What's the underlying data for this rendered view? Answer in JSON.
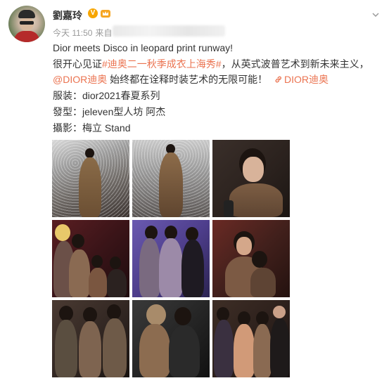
{
  "post": {
    "username": "劉嘉玲",
    "verified_badge": "V",
    "time": "今天 11:50",
    "source_prefix": "来自",
    "line1": "Dior meets Disco in leopard print runway!",
    "line2_prefix": "很开心见证",
    "line2_hashtag": "#迪奥二一秋季成衣上海秀#",
    "line2_suffix": "，从英式波普艺术到新未来主义，",
    "line3_mention": "@DIOR迪奥",
    "line3_text": " 始终都在诠释时装艺术的无限可能！",
    "line3_link_icon": "link-icon",
    "line3_link": "DIOR迪奥",
    "line4": "服装：dior2021春夏系列",
    "line5": "發型：jeleven型人坊 阿杰",
    "line6": "攝影：梅立 Stand"
  },
  "photos": [
    {
      "id": "photo-1",
      "desc": "runway-sequin-backdrop"
    },
    {
      "id": "photo-2",
      "desc": "runway-sequin-backdrop-2"
    },
    {
      "id": "photo-3",
      "desc": "portrait-close-up"
    },
    {
      "id": "photo-4",
      "desc": "group-photo-red-light"
    },
    {
      "id": "photo-5",
      "desc": "group-photo-purple-light"
    },
    {
      "id": "photo-6",
      "desc": "portrait-warm-light"
    },
    {
      "id": "photo-7",
      "desc": "group-photo-dark"
    },
    {
      "id": "photo-8",
      "desc": "hug-photo"
    },
    {
      "id": "photo-9",
      "desc": "group-photo-four"
    }
  ],
  "colors": {
    "link": "#eb7350",
    "text": "#333333",
    "meta": "#999999",
    "badge": "#f7a600"
  }
}
